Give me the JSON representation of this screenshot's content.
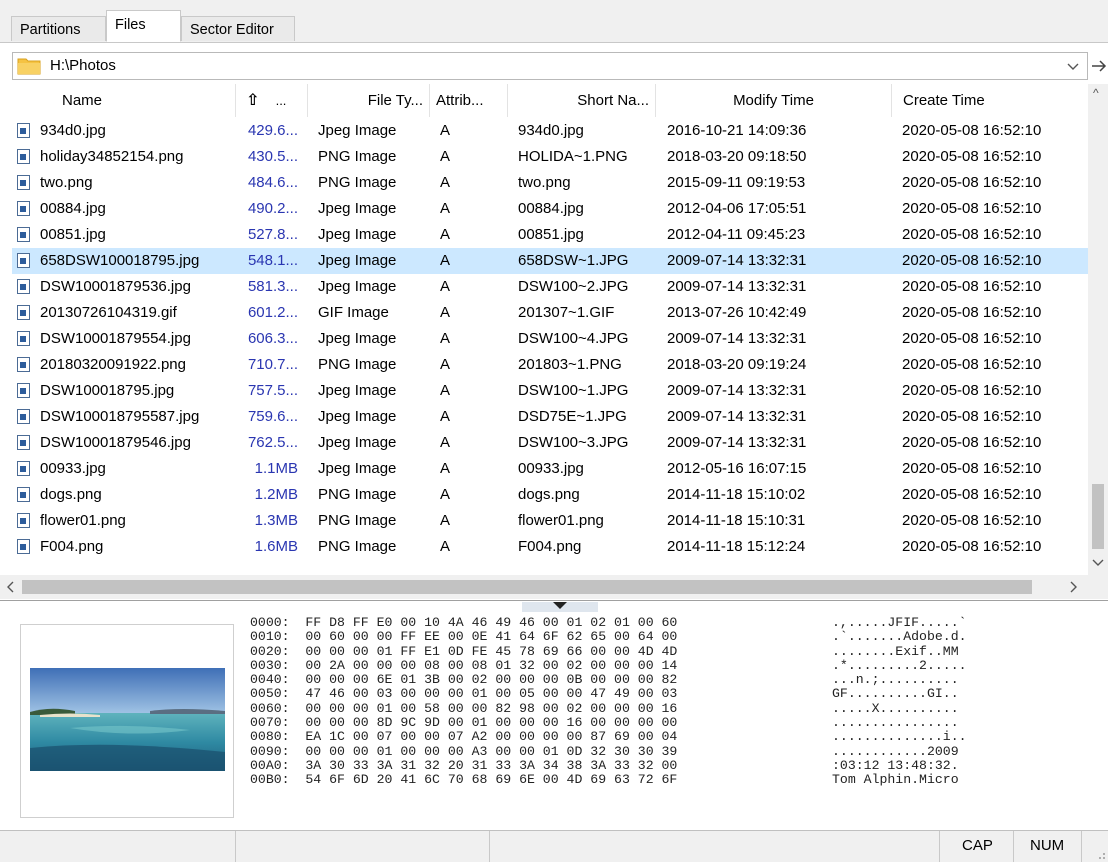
{
  "tabs": [
    {
      "label": "Partitions",
      "active": false
    },
    {
      "label": "Files",
      "active": true
    },
    {
      "label": "Sector Editor",
      "active": false
    }
  ],
  "path": {
    "value": "H:\\Photos",
    "dropdown_icon": "chevron-down-icon",
    "go_icon": "arrow-right-icon"
  },
  "columns": {
    "name": "Name",
    "size_sort_icon": "⇧",
    "size": "...",
    "type": "File Ty...",
    "attrib": "Attrib...",
    "short": "Short Na...",
    "modify": "Modify Time",
    "create": "Create Time"
  },
  "files": [
    {
      "name": "934d0.jpg",
      "size": "429.6...",
      "type": "Jpeg Image",
      "attrib": "A",
      "short": "934d0.jpg",
      "modify": "2016-10-21 14:09:36",
      "create": "2020-05-08 16:52:10"
    },
    {
      "name": "holiday34852154.png",
      "size": "430.5...",
      "type": "PNG Image",
      "attrib": "A",
      "short": "HOLIDA~1.PNG",
      "modify": "2018-03-20 09:18:50",
      "create": "2020-05-08 16:52:10"
    },
    {
      "name": "two.png",
      "size": "484.6...",
      "type": "PNG Image",
      "attrib": "A",
      "short": "two.png",
      "modify": "2015-09-11 09:19:53",
      "create": "2020-05-08 16:52:10"
    },
    {
      "name": "00884.jpg",
      "size": "490.2...",
      "type": "Jpeg Image",
      "attrib": "A",
      "short": "00884.jpg",
      "modify": "2012-04-06 17:05:51",
      "create": "2020-05-08 16:52:10"
    },
    {
      "name": "00851.jpg",
      "size": "527.8...",
      "type": "Jpeg Image",
      "attrib": "A",
      "short": "00851.jpg",
      "modify": "2012-04-11 09:45:23",
      "create": "2020-05-08 16:52:10"
    },
    {
      "name": "658DSW100018795.jpg",
      "size": "548.1...",
      "type": "Jpeg Image",
      "attrib": "A",
      "short": "658DSW~1.JPG",
      "modify": "2009-07-14 13:32:31",
      "create": "2020-05-08 16:52:10",
      "selected": true
    },
    {
      "name": "DSW10001879536.jpg",
      "size": "581.3...",
      "type": "Jpeg Image",
      "attrib": "A",
      "short": "DSW100~2.JPG",
      "modify": "2009-07-14 13:32:31",
      "create": "2020-05-08 16:52:10"
    },
    {
      "name": "20130726104319.gif",
      "size": "601.2...",
      "type": "GIF Image",
      "attrib": "A",
      "short": "201307~1.GIF",
      "modify": "2013-07-26 10:42:49",
      "create": "2020-05-08 16:52:10"
    },
    {
      "name": "DSW10001879554.jpg",
      "size": "606.3...",
      "type": "Jpeg Image",
      "attrib": "A",
      "short": "DSW100~4.JPG",
      "modify": "2009-07-14 13:32:31",
      "create": "2020-05-08 16:52:10"
    },
    {
      "name": "20180320091922.png",
      "size": "710.7...",
      "type": "PNG Image",
      "attrib": "A",
      "short": "201803~1.PNG",
      "modify": "2018-03-20 09:19:24",
      "create": "2020-05-08 16:52:10"
    },
    {
      "name": "DSW100018795.jpg",
      "size": "757.5...",
      "type": "Jpeg Image",
      "attrib": "A",
      "short": "DSW100~1.JPG",
      "modify": "2009-07-14 13:32:31",
      "create": "2020-05-08 16:52:10"
    },
    {
      "name": "DSW100018795587.jpg",
      "size": "759.6...",
      "type": "Jpeg Image",
      "attrib": "A",
      "short": "DSD75E~1.JPG",
      "modify": "2009-07-14 13:32:31",
      "create": "2020-05-08 16:52:10"
    },
    {
      "name": "DSW10001879546.jpg",
      "size": "762.5...",
      "type": "Jpeg Image",
      "attrib": "A",
      "short": "DSW100~3.JPG",
      "modify": "2009-07-14 13:32:31",
      "create": "2020-05-08 16:52:10"
    },
    {
      "name": "00933.jpg",
      "size": "1.1MB",
      "type": "Jpeg Image",
      "attrib": "A",
      "short": "00933.jpg",
      "modify": "2012-05-16 16:07:15",
      "create": "2020-05-08 16:52:10"
    },
    {
      "name": "dogs.png",
      "size": "1.2MB",
      "type": "PNG Image",
      "attrib": "A",
      "short": "dogs.png",
      "modify": "2014-11-18 15:10:02",
      "create": "2020-05-08 16:52:10"
    },
    {
      "name": "flower01.png",
      "size": "1.3MB",
      "type": "PNG Image",
      "attrib": "A",
      "short": "flower01.png",
      "modify": "2014-11-18 15:10:31",
      "create": "2020-05-08 16:52:10"
    },
    {
      "name": "F004.png",
      "size": "1.6MB",
      "type": "PNG Image",
      "attrib": "A",
      "short": "F004.png",
      "modify": "2014-11-18 15:12:24",
      "create": "2020-05-08 16:52:10"
    }
  ],
  "hex_dump": {
    "lines": [
      "0000:  FF D8 FF E0 00 10 4A 46 49 46 00 01 02 01 00 60",
      "0010:  00 60 00 00 FF EE 00 0E 41 64 6F 62 65 00 64 00",
      "0020:  00 00 00 01 FF E1 0D FE 45 78 69 66 00 00 4D 4D",
      "0030:  00 2A 00 00 00 08 00 08 01 32 00 02 00 00 00 14",
      "0040:  00 00 00 6E 01 3B 00 02 00 00 00 0B 00 00 00 82",
      "0050:  47 46 00 03 00 00 00 01 00 05 00 00 47 49 00 03",
      "0060:  00 00 00 01 00 58 00 00 82 98 00 02 00 00 00 16",
      "0070:  00 00 00 8D 9C 9D 00 01 00 00 00 16 00 00 00 00",
      "0080:  EA 1C 00 07 00 00 07 A2 00 00 00 00 87 69 00 04",
      "0090:  00 00 00 01 00 00 00 A3 00 00 01 0D 32 30 30 39",
      "00A0:  3A 30 33 3A 31 32 20 31 33 3A 34 38 3A 33 32 00",
      "00B0:  54 6F 6D 20 41 6C 70 68 69 6E 00 4D 69 63 72 6F"
    ],
    "ascii": [
      ".,.....JFIF.....`",
      ".`.......Adobe.d.",
      "........Exif..MM",
      ".*.........2.....",
      "...n.;..........",
      "GF..........GI..",
      ".....X..........",
      "................",
      "..............i..",
      "............2009",
      ":03:12 13:48:32.",
      "Tom Alphin.Micro"
    ]
  },
  "status": {
    "cap": "CAP",
    "num": "NUM"
  }
}
